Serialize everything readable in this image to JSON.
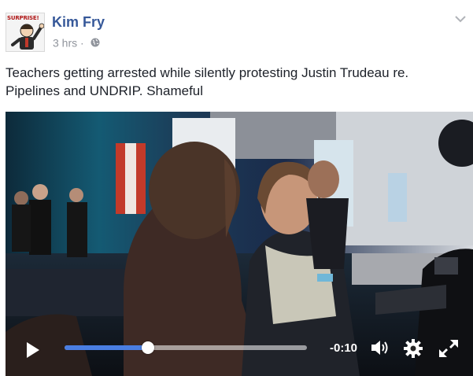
{
  "post": {
    "author": "Kim Fry",
    "time": "3 hrs",
    "separator": "·",
    "avatar_text": "SURPRISE!",
    "caption": "Teachers getting arrested while silently protesting Justin Trudeau re. Pipelines and UNDRIP. Shameful"
  },
  "video": {
    "time_remaining": "-0:10",
    "progress": 0.345,
    "accent_color": "#4a7ee2"
  },
  "icons": [
    "globe-icon",
    "chevron-down-icon",
    "play-icon",
    "volume-icon",
    "gear-icon",
    "fullscreen-icon"
  ]
}
